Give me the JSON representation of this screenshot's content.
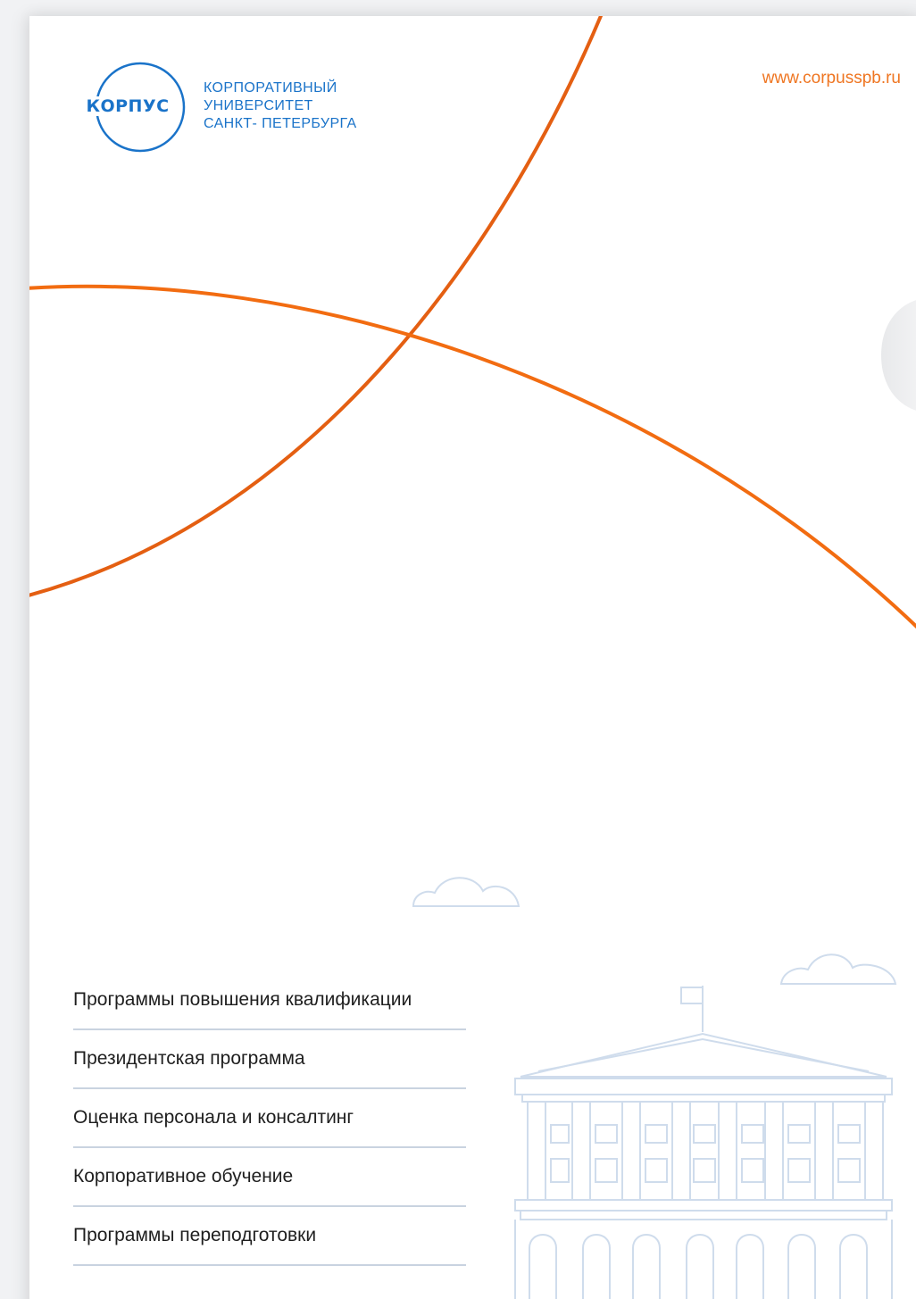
{
  "brand": {
    "logo_word": "КОРПУС",
    "name_lines": [
      "КОРПОРАТИВНЫЙ",
      "УНИВЕРСИТЕТ",
      "САНКТ- ПЕТЕРБУРГА"
    ],
    "accent_blue": "#1a73c9",
    "accent_orange": "#ef7622"
  },
  "header": {
    "url": "www.corpusspb.ru"
  },
  "menu": {
    "items": [
      {
        "label": "Программы повышения квалификации"
      },
      {
        "label": "Президентская программа"
      },
      {
        "label": "Оценка персонала и консалтинг"
      },
      {
        "label": "Корпоративное обучение"
      },
      {
        "label": "Программы переподготовки"
      }
    ]
  },
  "illustration": {
    "icons": [
      "cloud-icon",
      "cloud-icon",
      "building-icon"
    ]
  }
}
